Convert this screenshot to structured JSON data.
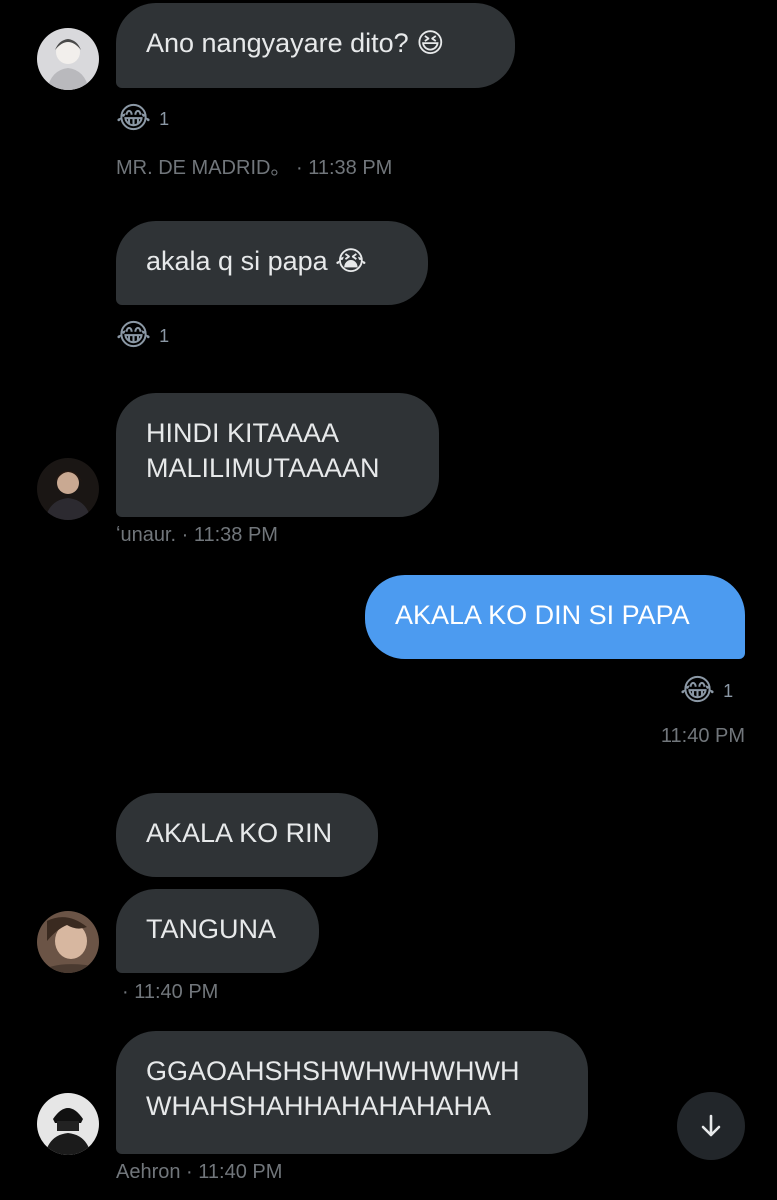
{
  "messages": [
    {
      "text": "Ano nangyayare dito? 😆",
      "reaction": {
        "emoji": "😂",
        "count": "1"
      },
      "meta": "MR. DE MADRID。 · 11:38 PM"
    },
    {
      "text": "akala q si papa 😭",
      "reaction": {
        "emoji": "😂",
        "count": "1"
      }
    },
    {
      "text": "HINDI KITAAAA MALILIMUTAAAAN",
      "line1": "HINDI KITAAAA",
      "line2": "MALILIMUTAAAAN",
      "meta": "ʻunaur. · 11:38 PM"
    },
    {
      "text": "AKALA KO DIN SI PAPA",
      "reaction": {
        "emoji": "😂",
        "count": "1"
      },
      "meta": "11:40 PM"
    },
    {
      "text": "AKALA KO RIN"
    },
    {
      "text": "TANGUNA",
      "meta": "· 11:40 PM"
    },
    {
      "text": "GGAOAHSHSHWHWHWHWH WHAHSHAHHAHAHAHAHA",
      "line1": "GGAOAHSHSHWHWHWHWH",
      "line2": "WHAHSHAHHAHAHAHAHA",
      "meta": "Aehron · 11:40 PM"
    }
  ],
  "scroll_button_icon": "arrow-down-icon",
  "colors": {
    "background": "#000000",
    "incoming_bubble": "#2f3336",
    "outgoing_bubble": "#4c9bf0",
    "meta_text": "#71767b"
  }
}
